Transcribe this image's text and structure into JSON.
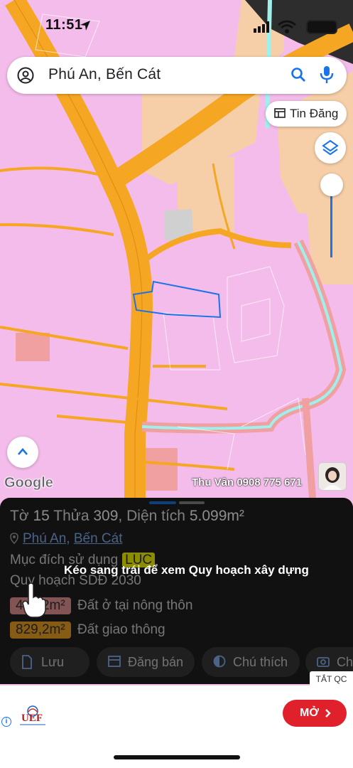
{
  "status_bar": {
    "time": "11:51"
  },
  "search": {
    "query": "Phú An, Bến Cát"
  },
  "map_controls": {
    "listing_button_label": "Tin Đăng"
  },
  "map_labels": {
    "google_logo": "Google",
    "agent_contact": "Thu Vân 0908 775 671"
  },
  "parcel": {
    "title_prefix": "Tờ",
    "sheet_no": "15",
    "parcel_label": "Thửa",
    "parcel_no": "309",
    "area_label": "Diện tích",
    "area_value": "5.099m²",
    "ward": "Phú An",
    "separator": ",",
    "district": "Bến Cát",
    "purpose_label": "Mục đích sử dụng",
    "purpose_code": "LUC",
    "plan_label": "Quy hoạch SDĐ 2030",
    "zones": [
      {
        "area": "4.282m²",
        "label": "Đất ở tại nông thôn"
      },
      {
        "area": "829,2m²",
        "label": "Đất giao thông"
      }
    ]
  },
  "actions": {
    "save": "Lưu",
    "post_sale": "Đăng bán",
    "legend": "Chú thích",
    "next": "Ch"
  },
  "hint": {
    "swipe_text": "Kéo sang trái để xem Quy hoạch xây dựng"
  },
  "ad": {
    "close_all": "TẮT QC",
    "brand": "UEF",
    "cta": "MỞ"
  },
  "colors": {
    "residential_pink": "#f4bcea",
    "road_orange": "#f5a623",
    "parcel_outline": "#1a73e8",
    "cta_red": "#e0202a"
  }
}
